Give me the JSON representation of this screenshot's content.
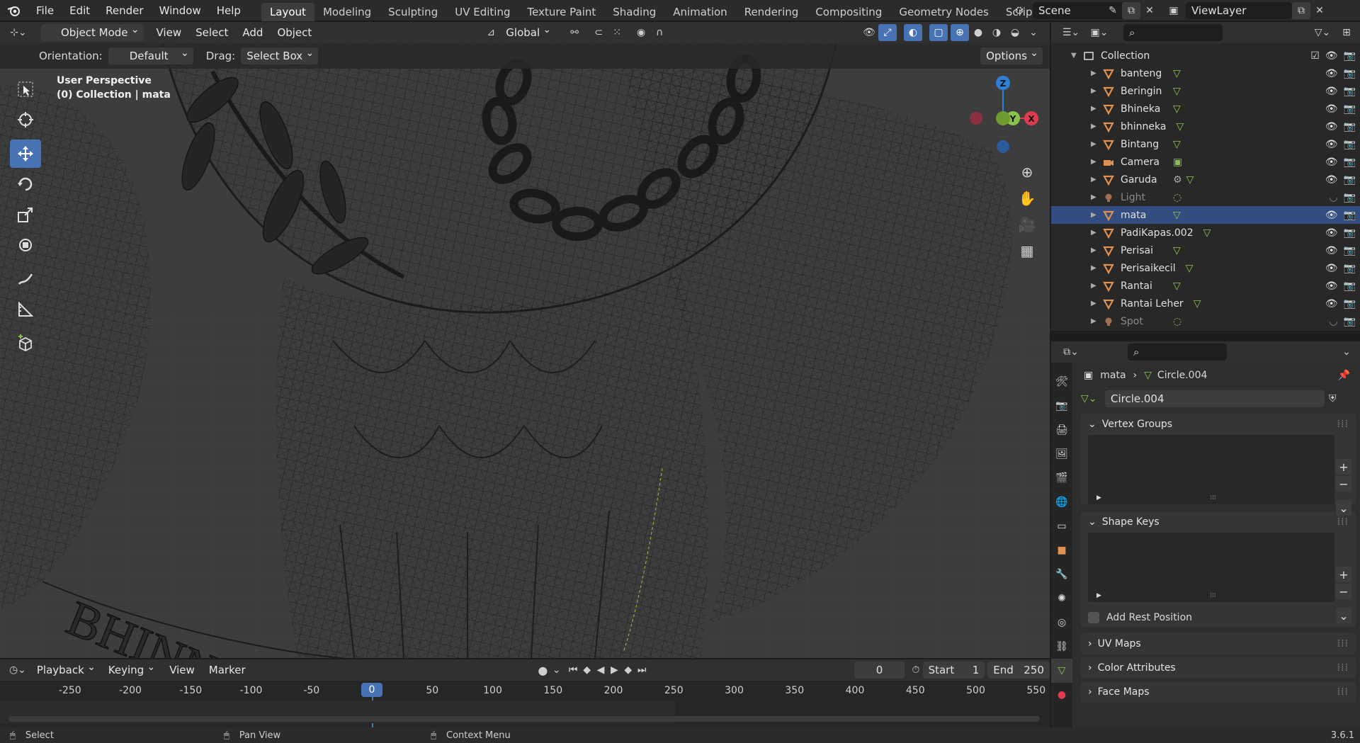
{
  "topbar": {
    "menus": [
      "File",
      "Edit",
      "Render",
      "Window",
      "Help"
    ],
    "workspaces": [
      "Layout",
      "Modeling",
      "Sculpting",
      "UV Editing",
      "Texture Paint",
      "Shading",
      "Animation",
      "Rendering",
      "Compositing",
      "Geometry Nodes",
      "Scripting"
    ],
    "active_workspace": "Layout",
    "scene": "Scene",
    "view_layer": "ViewLayer"
  },
  "viewport_header": {
    "mode": "Object Mode",
    "menus": [
      "View",
      "Select",
      "Add",
      "Object"
    ],
    "transform_orientation": "Global",
    "orientation_label": "Orientation:",
    "orientation_value": "Default",
    "drag_label": "Drag:",
    "drag_value": "Select Box",
    "options": "Options"
  },
  "viewport": {
    "perspective": "User Perspective",
    "collection_info": "(0) Collection | mata",
    "text_fragment": "BHINN",
    "gizmo": {
      "z": "Z",
      "y": "Y",
      "x": "X"
    }
  },
  "timeline": {
    "menus": [
      "Playback",
      "Keying",
      "View",
      "Marker"
    ],
    "current_frame": "0",
    "start_label": "Start",
    "start": "1",
    "end_label": "End",
    "end": "250",
    "ticks": [
      "-250",
      "-200",
      "-150",
      "-100",
      "-50",
      "0",
      "50",
      "100",
      "150",
      "200",
      "250",
      "300",
      "350",
      "400",
      "450",
      "500",
      "550"
    ]
  },
  "status": {
    "select": "Select",
    "pan": "Pan View",
    "context": "Context Menu",
    "version": "3.6.1"
  },
  "outliner": {
    "collection": "Collection",
    "items": [
      {
        "name": "banteng",
        "type": "mesh"
      },
      {
        "name": "Beringin",
        "type": "mesh"
      },
      {
        "name": "Bhineka",
        "type": "mesh"
      },
      {
        "name": "bhinneka",
        "type": "mesh"
      },
      {
        "name": "Bintang",
        "type": "mesh"
      },
      {
        "name": "Camera",
        "type": "camera"
      },
      {
        "name": "Garuda",
        "type": "mesh"
      },
      {
        "name": "Light",
        "type": "light"
      },
      {
        "name": "mata",
        "type": "mesh"
      },
      {
        "name": "PadiKapas.002",
        "type": "mesh"
      },
      {
        "name": "Perisai",
        "type": "mesh"
      },
      {
        "name": "Perisaikecil",
        "type": "mesh"
      },
      {
        "name": "Rantai",
        "type": "mesh"
      },
      {
        "name": "Rantai Leher",
        "type": "mesh"
      },
      {
        "name": "Spot",
        "type": "light"
      }
    ]
  },
  "properties": {
    "breadcrumb_object": "mata",
    "breadcrumb_data": "Circle.004",
    "data_name": "Circle.004",
    "panels": {
      "vertex_groups": "Vertex Groups",
      "shape_keys": "Shape Keys",
      "add_rest_position": "Add Rest Position",
      "uv_maps": "UV Maps",
      "color_attributes": "Color Attributes",
      "face_maps": "Face Maps"
    }
  },
  "colors": {
    "accent": "#4772b3",
    "mesh_icon": "#e09050",
    "selected_row": "#334d80",
    "axis_x": "#e03c50",
    "axis_y": "#8bc34a",
    "axis_z": "#2f7fd8",
    "frame_marker": "#4772b3"
  }
}
